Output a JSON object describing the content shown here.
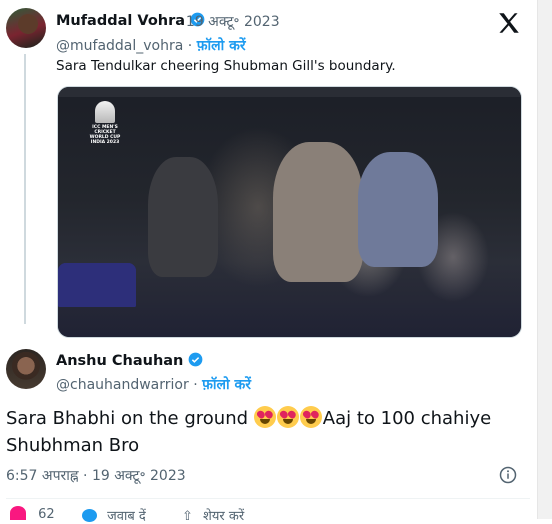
{
  "quoted_tweet": {
    "author_name": "Mufaddal Vohra",
    "separator": "·",
    "date": "19 अक्टू॰ 2023",
    "handle": "@mufaddal_vohra",
    "follow_label": "फ़ॉलो करें",
    "text": "Sara Tendulkar cheering Shubman Gill's boundary.",
    "media_logo_text": "ICC MEN'S CRICKET WORLD CUP INDIA 2023"
  },
  "tweet": {
    "author_name": "Anshu Chauhan",
    "handle": "@chauhandwarrior",
    "separator": "·",
    "follow_label": "फ़ॉलो करें",
    "text_part1": "Sara Bhabhi on the ground ",
    "text_part2": "Aaj to 100 chahiye Shubhman Bro",
    "emojis": [
      "heart-eyes-emoji",
      "heart-eyes-emoji",
      "heart-eyes-emoji"
    ],
    "timestamp": "6:57 अपराह्न · 19 अक्टू॰ 2023"
  },
  "actions": {
    "likes_count": "62",
    "reply_label": "जवाब दें",
    "share_label": "शेयर करें"
  },
  "colors": {
    "accent": "#1d9bf0",
    "verified": "#1d9bf0",
    "like": "#f91880",
    "muted": "#536471"
  }
}
